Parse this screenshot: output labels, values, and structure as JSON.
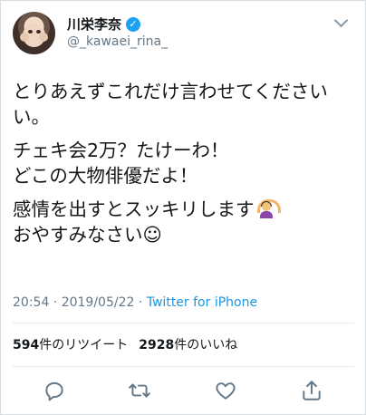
{
  "tweet": {
    "author": {
      "display_name": "川栄李奈",
      "handle": "@_kawaei_rina_",
      "verified": true
    },
    "paragraphs": [
      [
        "とりあえずこれだけ言わせてください",
        "い。"
      ],
      [
        "チェキ会2万？たけーわ！",
        "どこの大物俳優だよ！"
      ],
      [
        "感情を出すとスッキリします",
        "おやすみなさい☺"
      ]
    ],
    "emoji": {
      "after_paragraph_3_line_1": "person-gesturing-ok-emoji"
    },
    "timestamp": "20:54 · 2019/05/22 · ",
    "source": "Twitter for iPhone",
    "stats": {
      "retweets_count": "594",
      "retweets_label": "件のリツイート",
      "likes_count": "2928",
      "likes_label": "件のいいね"
    },
    "actions": [
      "reply-icon",
      "retweet-icon",
      "like-icon",
      "share-icon"
    ]
  },
  "colors": {
    "text": "#14171a",
    "secondary": "#657786",
    "link": "#1b95e0",
    "verified": "#1da1f2",
    "divider": "#e6ecf0",
    "icon": "#657786"
  }
}
